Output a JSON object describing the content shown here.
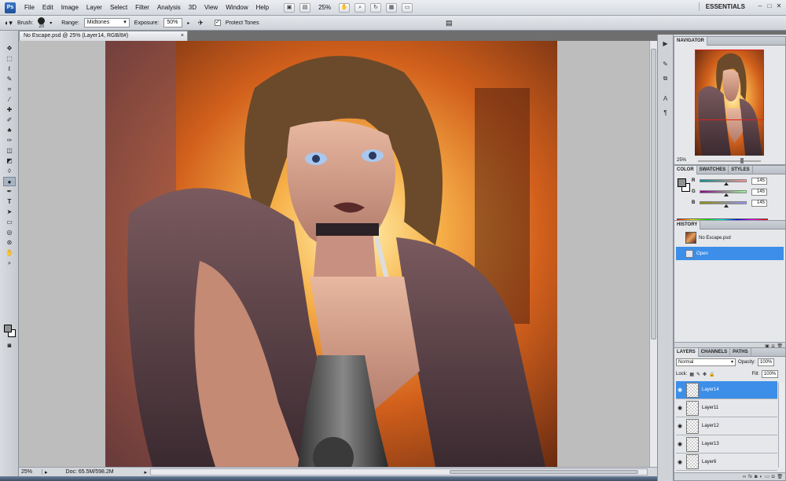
{
  "menubar": {
    "logo": "Ps",
    "items": [
      "File",
      "Edit",
      "Image",
      "Layer",
      "Select",
      "Filter",
      "Analysis",
      "3D",
      "View",
      "Window",
      "Help"
    ],
    "zoom": "25%",
    "workspace": "ESSENTIALS",
    "window_buttons": [
      "–",
      "□",
      "✕"
    ]
  },
  "options": {
    "brush_label": "Brush:",
    "brush_size": "20",
    "range_label": "Range:",
    "range_value": "Midtones",
    "exposure_label": "Exposure:",
    "exposure_value": "50%",
    "protect_label": "Protect Tones",
    "protect_checked": "✓"
  },
  "document": {
    "tab_title": "No Escape.psd @ 25% (Layer14, RGB/8#)",
    "close": "×",
    "status_zoom": "25%",
    "status_doc": "Doc: 65.5M/598.2M"
  },
  "navigator": {
    "tab": "NAVIGATOR",
    "zoom": "25%"
  },
  "color": {
    "tabs": [
      "COLOR",
      "SWATCHES",
      "STYLES"
    ],
    "r_label": "R",
    "r_value": "145",
    "g_label": "G",
    "g_value": "145",
    "b_label": "B",
    "b_value": "145",
    "fg_color": "#919191"
  },
  "history": {
    "tab": "HISTORY",
    "snapshot": "No Escape.psd",
    "states": [
      "Open"
    ]
  },
  "layers": {
    "tabs": [
      "LAYERS",
      "CHANNELS",
      "PATHS"
    ],
    "blend_mode": "Normal",
    "opacity_label": "Opacity:",
    "opacity": "100%",
    "lock_label": "Lock:",
    "fill_label": "Fill:",
    "fill": "100%",
    "items": [
      "Layer14",
      "Layer11",
      "Layer12",
      "Layer13",
      "Layer6"
    ]
  }
}
